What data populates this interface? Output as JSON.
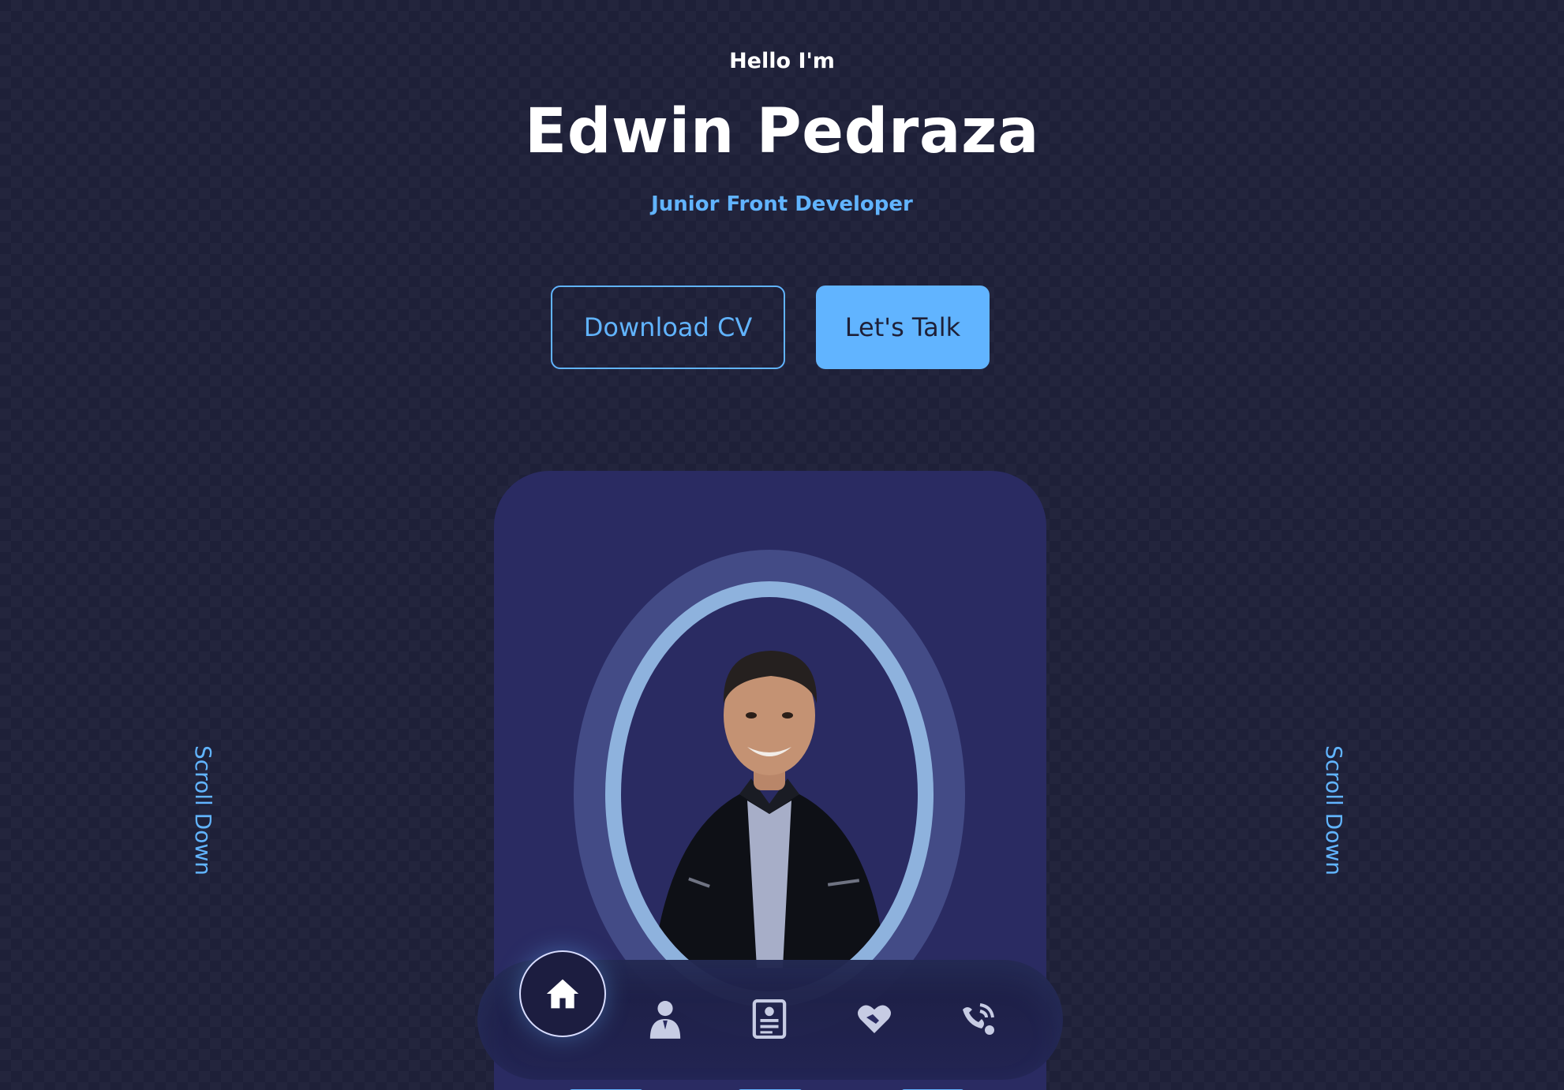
{
  "hero": {
    "greeting": "Hello I'm",
    "name": "Edwin Pedraza",
    "role": "Junior Front Developer"
  },
  "buttons": {
    "download_cv": "Download CV",
    "lets_talk": "Let's Talk"
  },
  "scroll": {
    "left_label": "Scroll Down",
    "right_label": "Scroll Down"
  },
  "nav": {
    "items": [
      {
        "icon": "home-icon",
        "active": true
      },
      {
        "icon": "person-icon",
        "active": false
      },
      {
        "icon": "resume-icon",
        "active": false
      },
      {
        "icon": "heart-handshake-icon",
        "active": false
      },
      {
        "icon": "contact-icon",
        "active": false
      }
    ]
  },
  "colors": {
    "background": "#1e2038",
    "accent": "#61b4ff",
    "card": "#2a2b62",
    "ring": "#8eb2dd"
  }
}
